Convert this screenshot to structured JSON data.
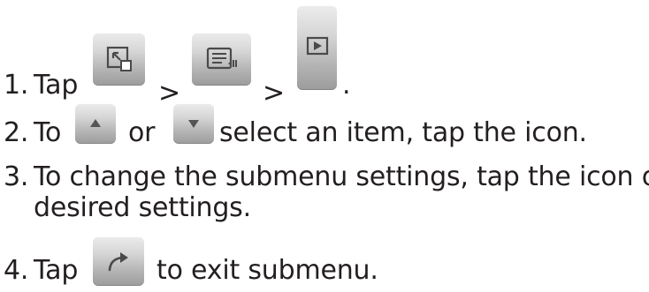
{
  "steps": [
    {
      "number": "1.",
      "verb": "Tap",
      "sep1": ">",
      "sep2": ">",
      "end": ".",
      "icons": [
        "select-area-icon",
        "menu-list-icon",
        "play-icon"
      ]
    },
    {
      "number": "2.",
      "verb": "To",
      "or": "or",
      "rest": "select an item, tap the icon.",
      "icons": [
        "up-arrow-icon",
        "down-arrow-icon"
      ]
    },
    {
      "number": "3.",
      "line1": "To change the submenu settings, tap the icon of",
      "line2": "desired settings."
    },
    {
      "number": "4.",
      "verb": "Tap",
      "rest": "to exit submenu.",
      "icons": [
        "exit-arrow-icon"
      ]
    }
  ]
}
